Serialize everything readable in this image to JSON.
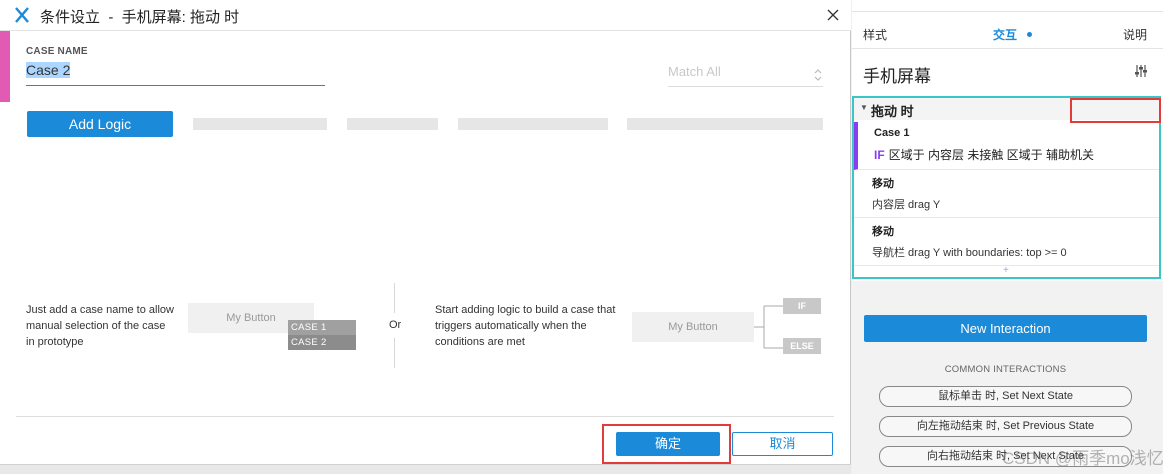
{
  "dialog": {
    "title": "条件设立  -  手机屏幕: 拖动 时",
    "case_name_label": "CASE NAME",
    "case_name_value": "Case 2",
    "match_select": "Match All",
    "add_logic_label": "Add Logic",
    "help_left": "Just add a case name to allow manual selection of the case in prototype",
    "mock_button_1": "My Button",
    "case1_tag": "CASE 1",
    "case2_tag": "CASE 2",
    "or_label": "Or",
    "help_right": "Start adding logic to build a case that triggers automatically when the conditions are met",
    "mock_button_2": "My Button",
    "if_tag": "IF",
    "else_tag": "ELSE",
    "ok_label": "确定",
    "cancel_label": "取消"
  },
  "panel": {
    "tabs": {
      "style": "样式",
      "interact": "交互",
      "notes": "说明"
    },
    "widget_name": "手机屏幕",
    "event_title": "拖动 时",
    "case1": {
      "title": "Case 1",
      "if_keyword": "IF",
      "condition": "区域于 内容层 未接触 区域于 辅助机关"
    },
    "move1": {
      "title": "移动",
      "detail": "内容层 drag Y"
    },
    "move2": {
      "title": "移动",
      "detail": "导航栏 drag Y  with boundaries: top >= 0"
    },
    "add_symbol": "+",
    "new_interaction_label": "New Interaction",
    "common_label": "COMMON INTERACTIONS",
    "common_items": [
      "鼠标单击 时, Set Next State",
      "向左拖动结束 时, Set Previous State",
      "向右拖动结束 时, Set Next State"
    ],
    "watermark": "CSDN @雨季mo浅忆"
  },
  "colors": {
    "accent": "#1a8ad9",
    "case_accent": "#8a3ef0",
    "highlight": "#e33a3a",
    "interaction_border": "#39c6c6",
    "pink": "#e15ab4"
  }
}
